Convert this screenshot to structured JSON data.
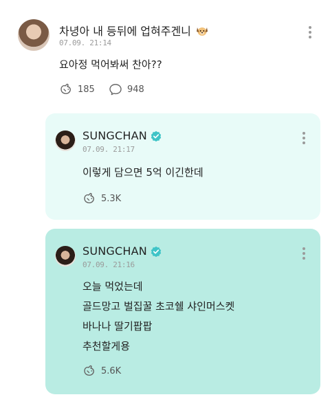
{
  "post": {
    "author": "차녕아 내 등뒤에 업혀주겐니",
    "author_emoji_icon": "dog-face-icon",
    "time": "07.09. 21:14",
    "message": "요아정 먹어봐써 찬아??",
    "likes": "185",
    "comments": "948"
  },
  "replies": [
    {
      "author": "SUNGCHAN",
      "verified_icon": "verified-badge-icon",
      "time": "07.09. 21:17",
      "lines": [
        "이렇게 담으면 5억 이긴한데"
      ],
      "likes": "5.3K",
      "bg": "#e8fbf8"
    },
    {
      "author": "SUNGCHAN",
      "verified_icon": "verified-badge-icon",
      "time": "07.09. 21:16",
      "lines": [
        "오늘 먹었는데",
        "골드망고 벌집꿀 초코쉘 샤인머스켓",
        "바나나 딸기팝팝",
        "추천할게용"
      ],
      "likes": "5.6K",
      "bg": "#b9ece3"
    }
  ],
  "colors": {
    "accent_teal": "#3fc4c7",
    "card_light": "#e8fbf8",
    "card_dark": "#b9ece3",
    "meta_gray": "#9a9a9a"
  }
}
